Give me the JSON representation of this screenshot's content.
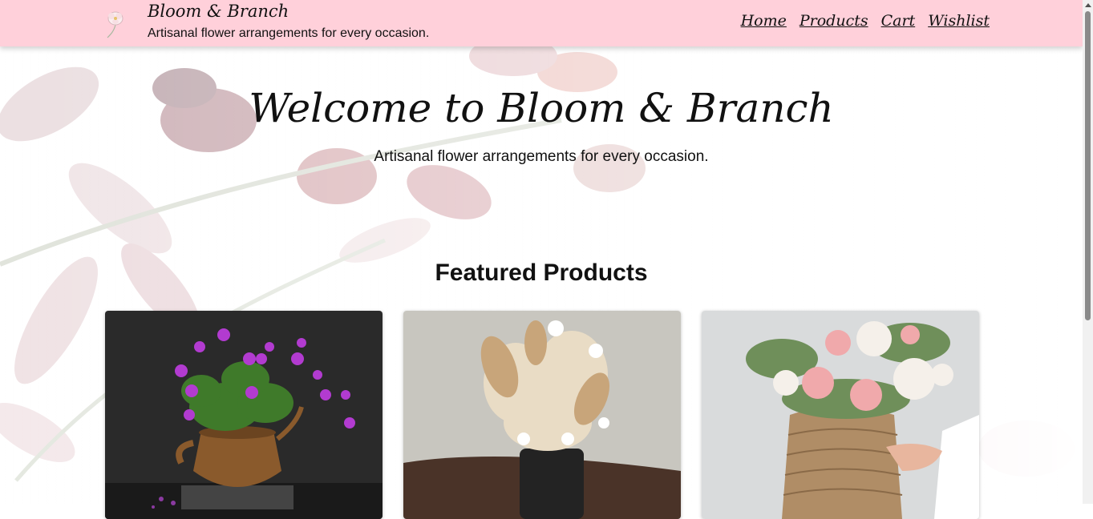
{
  "header": {
    "brand_name": "Bloom & Branch",
    "tagline": "Artisanal flower arrangements for every occasion.",
    "logo_icon": "flower-logo-icon",
    "nav": [
      {
        "label": "Home"
      },
      {
        "label": "Products"
      },
      {
        "label": "Cart"
      },
      {
        "label": "Wishlist"
      }
    ],
    "background_color": "#ffd0da"
  },
  "hero": {
    "title": "Welcome to Bloom & Branch",
    "subtitle": "Artisanal flower arrangements for every occasion."
  },
  "featured": {
    "title": "Featured Products",
    "products": [
      {
        "image": "purple-geraniums-in-copper-kettle"
      },
      {
        "image": "dried-pampas-bouquet-in-black-vase"
      },
      {
        "image": "pink-white-roses-in-wicker-basket"
      }
    ]
  }
}
